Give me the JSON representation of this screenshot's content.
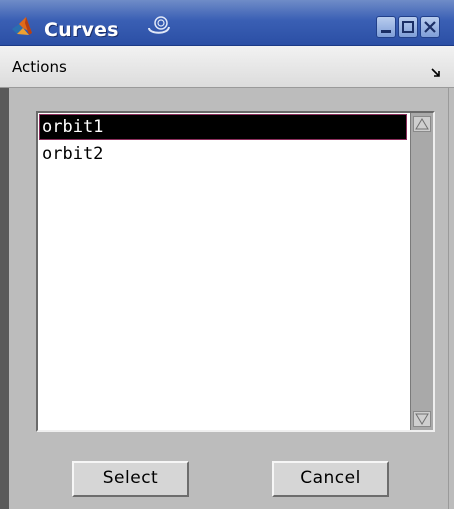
{
  "window": {
    "title": "Curves",
    "app_icon": "matlab-icon",
    "controls": [
      "minimize-icon",
      "maximize-icon",
      "close-icon"
    ]
  },
  "menubar": {
    "actions_label": "Actions",
    "pin_icon": "dock-arrow-icon"
  },
  "list": {
    "items": [
      {
        "label": "orbit1",
        "selected": true
      },
      {
        "label": "orbit2",
        "selected": false
      }
    ]
  },
  "buttons": {
    "select_label": "Select",
    "cancel_label": "Cancel"
  },
  "colors": {
    "titlebar": "#3a5fb4",
    "selection_bg": "#000000",
    "selection_fg": "#ffffff",
    "panel_bg": "#bcbcbc"
  }
}
